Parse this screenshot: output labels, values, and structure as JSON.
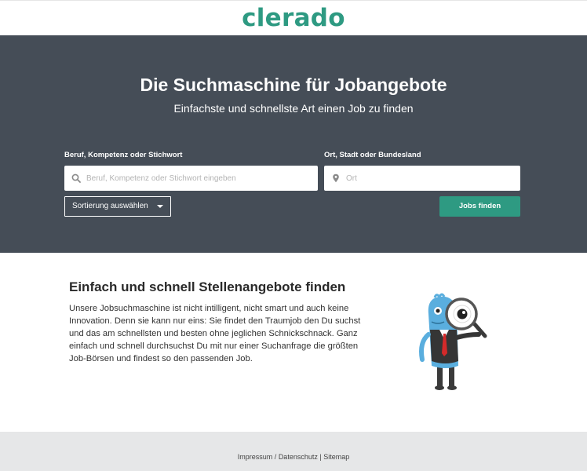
{
  "header": {
    "logo_text": "clerado"
  },
  "hero": {
    "title": "Die Suchmaschine für Jobangebote",
    "subtitle": "Einfachste und schnellste Art einen Job zu finden"
  },
  "search": {
    "keyword_label": "Beruf, Kompetenz oder Stichwort",
    "keyword_placeholder": "Beruf, Kompetenz oder Stichwort eingeben",
    "keyword_value": "",
    "location_label": "Ort, Stadt oder Bundesland",
    "location_placeholder": "Ort",
    "location_value": "",
    "sort_label": "Sortierung auswählen",
    "submit_label": "Jobs finden"
  },
  "content": {
    "title": "Einfach und schnell Stellenangebote finden",
    "body": "Unsere Jobsuchmaschine ist nicht intilligent, nicht smart und auch keine Innovation. Denn sie kann nur eins: Sie findet den Traumjob den Du suchst und das am schnellsten und besten ohne jeglichen Schnickschnack. Ganz einfach und schnell durchsuchst Du mit nur einer Suchanfrage die größten Job-Börsen und findest so den passenden Job."
  },
  "footer": {
    "impressum": "Impressum",
    "sep1": " / ",
    "datenschutz": "Datenschutz",
    "sep2": " | ",
    "sitemap": "Sitemap"
  },
  "icons": {
    "keyword": "search-icon",
    "location": "map-pin-icon",
    "sort": "chevron-down-icon",
    "mascot": "mascot-magnifier-illustration"
  },
  "colors": {
    "brand": "#2e9a82",
    "hero_bg": "#454d57",
    "footer_bg": "#e6e7e8"
  }
}
